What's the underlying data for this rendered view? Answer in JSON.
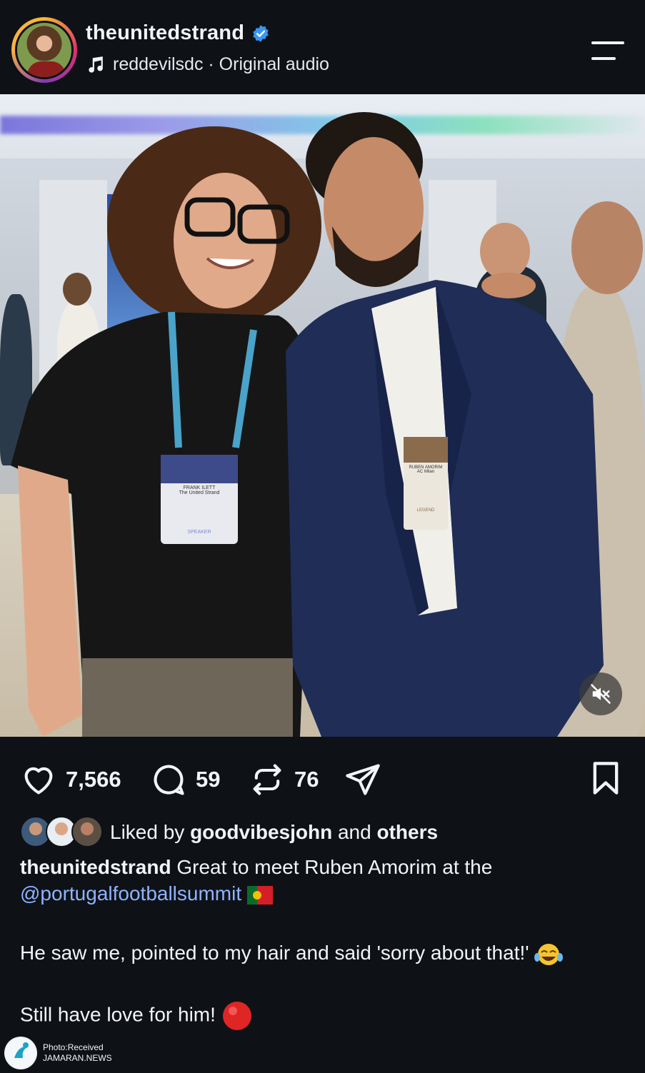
{
  "header": {
    "username": "theunitedstrand",
    "audio_label": "reddevilsdc · Original audio"
  },
  "actions": {
    "likes": "7,566",
    "comments": "59",
    "reposts": "76"
  },
  "liked_by": {
    "prefix": "Liked by ",
    "user": "goodvibesjohn",
    "middle": " and ",
    "others": "others"
  },
  "caption": {
    "author": "theunitedstrand",
    "line1_text": " Great to meet Ruben Amorim at the",
    "mention": "@portugalfootballsummit",
    "para2": "He saw me, pointed to my hair and said 'sorry about that!'",
    "para3": "Still have love for him!"
  },
  "badge": {
    "speaker_name": "FRANK ILETT",
    "speaker_org": "The United Strand",
    "speaker_role": "SPEAKER",
    "guest_name": "RUBEN AMORIM",
    "guest_club": "AC Milan",
    "guest_role": "LEGEND"
  },
  "watermark": {
    "line1": "Photo:Received",
    "line2": "JAMARAN.NEWS"
  },
  "colors": {
    "background": "#0e1217",
    "verified": "#3897f0",
    "mention": "#8fb3ff"
  }
}
